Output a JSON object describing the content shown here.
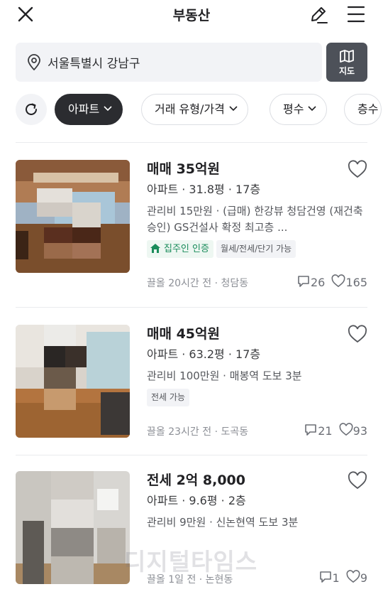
{
  "header": {
    "title": "부동산"
  },
  "search": {
    "location": "서울특별시 강남구",
    "map_label": "지도"
  },
  "filters": [
    {
      "label": "아파트",
      "active": true
    },
    {
      "label": "거래 유형/가격",
      "active": false
    },
    {
      "label": "평수",
      "active": false
    },
    {
      "label": "층수",
      "active": false
    }
  ],
  "listings": [
    {
      "price": "매매 35억원",
      "spec": "아파트 · 31.8평 · 17층",
      "desc": "관리비 15만원 · (급매) 한강뷰 청담건영 (재건축승인) GS건설사 확정 최고층 ...",
      "tags": [
        "집주인 인증",
        "월세/전세/단기 가능"
      ],
      "meta": "끌올 20시간 전 · 청담동",
      "chats": "26",
      "likes": "165"
    },
    {
      "price": "매매 45억원",
      "spec": "아파트 · 63.2평 · 17층",
      "desc": "관리비 100만원 · 매봉역 도보 3분",
      "tags": [
        "전세 가능"
      ],
      "meta": "끌올 23시간 전 · 도곡동",
      "chats": "21",
      "likes": "93"
    },
    {
      "price": "전세 2억 8,000",
      "spec": "아파트 · 9.6평 · 2층",
      "desc": "관리비 9만원 · 신논현역 도보 3분",
      "tags": [],
      "meta": "끌올 1일 전 · 논현동",
      "chats": "1",
      "likes": "9"
    }
  ],
  "watermark": "디지털타임스",
  "colors": {
    "active_chip": "#2b2c30",
    "verified": "#1a8c5b",
    "map_button": "#4d5159"
  }
}
